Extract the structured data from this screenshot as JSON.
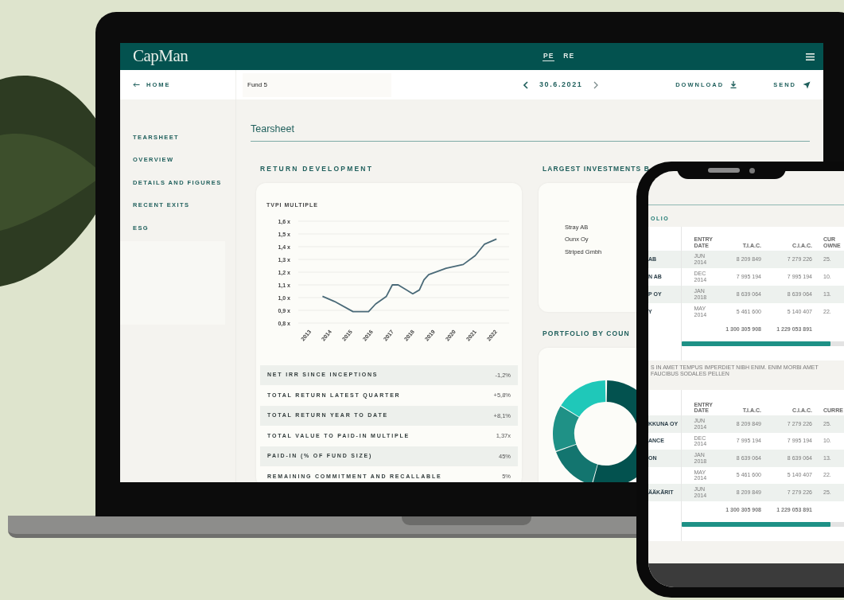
{
  "laptop": {
    "app_header": {
      "logo": "CapMan",
      "tabs": [
        {
          "label": "PE",
          "selected": true
        },
        {
          "label": "RE",
          "selected": false
        }
      ]
    },
    "toolbar": {
      "back": "HOME",
      "fund": "Fund 5",
      "date": "30.6.2021",
      "download": "DOWNLOAD",
      "send": "SEND"
    },
    "sidebar": {
      "items": [
        {
          "label": "TEARSHEET"
        },
        {
          "label": "OVERVIEW"
        },
        {
          "label": "DETAILS AND FIGURES"
        },
        {
          "label": "RECENT EXITS"
        },
        {
          "label": "ESG"
        }
      ]
    },
    "page_title": "Tearsheet",
    "return_development": {
      "title": "RETURN DEVELOPMENT",
      "chart_data": {
        "type": "line",
        "ylabel": "TVPI MULTIPLE",
        "x": [
          2013.77,
          2014.35,
          2015.25,
          2016.0,
          2016.34,
          2016.86,
          2017.15,
          2017.43,
          2018.14,
          2018.46,
          2018.68,
          2018.91,
          2019.75,
          2020.58,
          2021.16,
          2021.61,
          2022.19
        ],
        "series": [
          {
            "color": "#4a6a78",
            "values": [
              1.01,
              0.97,
              0.89,
              0.89,
              0.95,
              1.01,
              1.1,
              1.1,
              1.03,
              1.06,
              1.14,
              1.18,
              1.23,
              1.26,
              1.33,
              1.42,
              1.46
            ]
          }
        ],
        "xlim": [
          2012.6,
          2022.8
        ],
        "ylim": [
          0.8,
          1.6
        ],
        "grid": true,
        "xticks": [
          {
            "value": 2013,
            "label": "2013"
          },
          {
            "value": 2014,
            "label": "2014"
          },
          {
            "value": 2015,
            "label": "2015"
          },
          {
            "value": 2016,
            "label": "2016"
          },
          {
            "value": 2017,
            "label": "2017"
          },
          {
            "value": 2018,
            "label": "2018"
          },
          {
            "value": 2019,
            "label": "2019"
          },
          {
            "value": 2020,
            "label": "2020"
          },
          {
            "value": 2021,
            "label": "2021"
          },
          {
            "value": 2022,
            "label": "2022"
          }
        ],
        "yticks": [
          {
            "value": 1.6,
            "label": "1,6 x"
          },
          {
            "value": 1.5,
            "label": "1,5 x"
          },
          {
            "value": 1.4,
            "label": "1,4 x"
          },
          {
            "value": 1.3,
            "label": "1,3 x"
          },
          {
            "value": 1.2,
            "label": "1,2 x"
          },
          {
            "value": 1.1,
            "label": "1,1 x"
          },
          {
            "value": 1.0,
            "label": "1,0 x"
          },
          {
            "value": 0.9,
            "label": "0,9 x"
          },
          {
            "value": 0.8,
            "label": "0,8 x"
          }
        ]
      },
      "metrics": [
        {
          "label": "NET IRR SINCE INCEPTIONS",
          "value": "-1,2%"
        },
        {
          "label": "TOTAL RETURN LATEST QUARTER",
          "value": "+5,8%"
        },
        {
          "label": "TOTAL RETURN YEAR TO DATE",
          "value": "+8,1%"
        },
        {
          "label": "TOTAL VALUE TO PAID-IN MULTIPLE",
          "value": "1,37x"
        },
        {
          "label": "PAID-IN (% OF FUND SIZE)",
          "value": "45%"
        },
        {
          "label": "REMAINING COMMITMENT AND RECALLABLE",
          "value": "5%"
        }
      ]
    },
    "largest_investments": {
      "title": "LARGEST INVESTMENTS B",
      "items": [
        "Stray AB",
        "Ounx Oy",
        "Striped Gmbh"
      ]
    },
    "portfolio_by_country": {
      "title": "PORTFOLIO BY COUN"
    }
  },
  "phone": {
    "section_title": "OLIO",
    "tables": [
      {
        "columns": [
          "ENTRY DATE",
          "T.I.A.C.",
          "C.I.A.C.",
          "CUR OWNE"
        ],
        "rows": [
          {
            "name": "AB",
            "entry_date": "JUN 2014",
            "tiac": "8 209 849",
            "ciac": "7 279 226",
            "ownership": "25."
          },
          {
            "name": "N AB",
            "entry_date": "DEC 2014",
            "tiac": "7 995 194",
            "ciac": "7 995 194",
            "ownership": "10."
          },
          {
            "name": "P OY",
            "entry_date": "JAN 2018",
            "tiac": "8 639 064",
            "ciac": "8 639 064",
            "ownership": "13."
          },
          {
            "name": "Y",
            "entry_date": "MAY 2014",
            "tiac": "5 461 600",
            "ciac": "5 140 407",
            "ownership": "22."
          }
        ],
        "totals": {
          "tiac": "1 300 305 908",
          "ciac": "1 229 053 891"
        },
        "progress": {
          "level": 0.85
        },
        "note": "S IN AMET TEMPUS IMPERDIET NIBH ENIM. ENIM MORBI AMET FAUCIBUS SODALES PELLEN"
      },
      {
        "columns": [
          "ENTRY DATE",
          "T.I.A.C.",
          "C.I.A.C.",
          "CURRE"
        ],
        "rows": [
          {
            "name": "KKUNA OY",
            "entry_date": "JUN 2014",
            "tiac": "8 209 849",
            "ciac": "7 279 226",
            "ownership": "25."
          },
          {
            "name": "ANCE",
            "entry_date": "DEC 2014",
            "tiac": "7 995 194",
            "ciac": "7 995 194",
            "ownership": "10."
          },
          {
            "name": "ON",
            "entry_date": "JAN 2018",
            "tiac": "8 639 064",
            "ciac": "8 639 064",
            "ownership": "13."
          },
          {
            "entry_date": "MAY 2014",
            "tiac": "5 461 600",
            "ciac": "5 140 407",
            "ownership": "22."
          },
          {
            "name": "ÄÄKÄRIT",
            "entry_date": "JUN 2014",
            "tiac": "8 209 849",
            "ciac": "7 279 226",
            "ownership": "25."
          }
        ],
        "totals": {
          "tiac": "1 300 305 908",
          "ciac": "1 229 053 891"
        },
        "progress": {
          "level": 0.85
        }
      }
    ]
  }
}
